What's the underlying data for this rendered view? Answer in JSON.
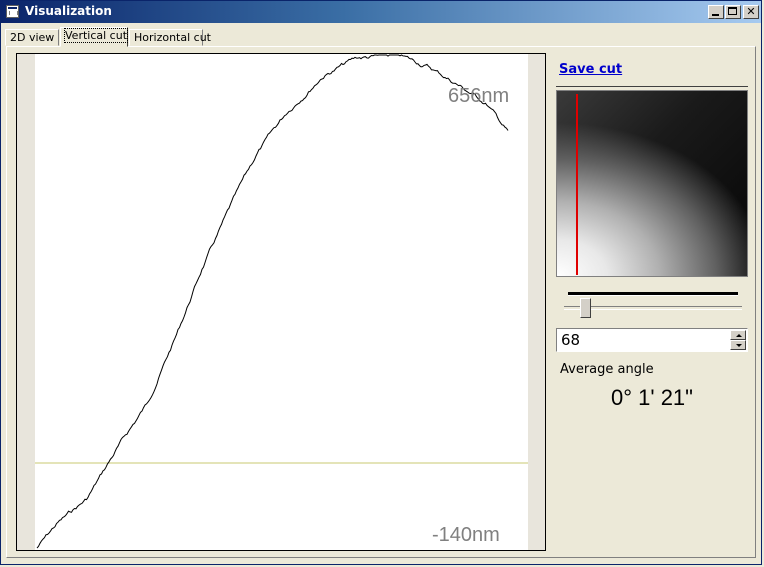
{
  "window": {
    "title": "Visualization"
  },
  "tabs": [
    {
      "label": "2D view",
      "active": false
    },
    {
      "label": "Vertical cut",
      "active": true
    },
    {
      "label": "Horizontal cut",
      "active": false
    }
  ],
  "plot": {
    "max_label": "656nm",
    "min_label": "-140nm",
    "profile_color": "#000000",
    "reference_color": "#c8c870"
  },
  "side": {
    "save_link": "Save cut",
    "cut_value": "68",
    "average_label": "Average angle",
    "average_value": "0° 1' 21\""
  },
  "colors": {
    "accent_title": "#0a246a",
    "cut_marker": "#e00000",
    "link": "#0000cc"
  }
}
